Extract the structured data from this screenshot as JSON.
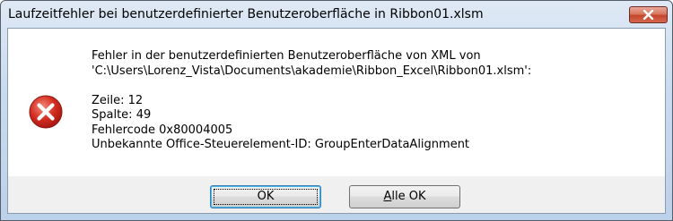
{
  "window": {
    "title": "Laufzeitfehler bei benutzerdefinierter Benutzeroberfläche in Ribbon01.xlsm"
  },
  "message": {
    "line1": "Fehler in der benutzerdefinierten Benutzeroberfläche von XML von",
    "line2": "'C:\\Users\\Lorenz_Vista\\Documents\\akademie\\Ribbon_Excel\\Ribbon01.xlsm':",
    "line3": "Zeile: 12",
    "line4": "Spalte: 49",
    "line5": "Fehlercode 0x80004005",
    "line6": "Unbekannte Office-Steuerelement-ID: GroupEnterDataAlignment"
  },
  "buttons": {
    "ok_label": "OK",
    "all_ok_accel": "A",
    "all_ok_rest": "lle OK"
  },
  "icons": {
    "error": "error-icon",
    "close": "close-icon"
  },
  "colors": {
    "error_red": "#c8201a",
    "close_red": "#c4452c",
    "title_gradient_top": "#dfe9f5"
  }
}
